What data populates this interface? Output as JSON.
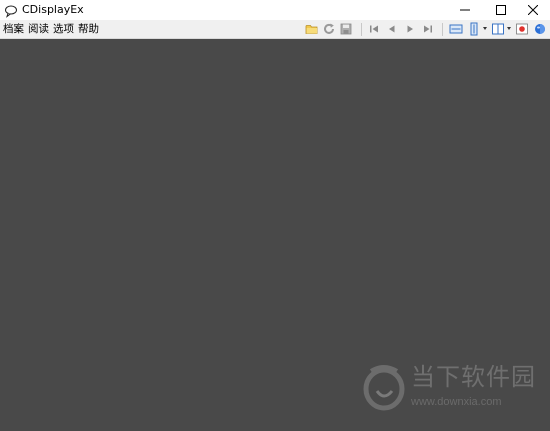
{
  "window": {
    "title": "CDisplayEx",
    "icon": "speech-bubble-icon",
    "controls": [
      "minimize-icon",
      "maximize-icon",
      "close-icon"
    ]
  },
  "menu": {
    "items": [
      {
        "label": "档案"
      },
      {
        "label": "阅读"
      },
      {
        "label": "选项"
      },
      {
        "label": "帮助"
      }
    ]
  },
  "toolbar": {
    "buttons": [
      "folder-open-icon",
      "refresh-icon",
      "save-icon",
      "first-page-icon",
      "previous-page-icon",
      "next-page-icon",
      "last-page-icon",
      "fit-width-icon",
      "fit-height-icon",
      "page-layout-icon",
      "record-icon",
      "globe-icon"
    ]
  },
  "viewer": {
    "background": "#494949"
  },
  "watermark": {
    "name": "当下软件园",
    "url": "www.downxia.com",
    "logo": "downxia-logo"
  },
  "colors": {
    "titlebar": "#ffffff",
    "toolbar": "#f0f0f0",
    "viewer": "#494949",
    "folder": "#f2c94c",
    "record": "#e0322d",
    "globe": "#2b6fd6"
  }
}
